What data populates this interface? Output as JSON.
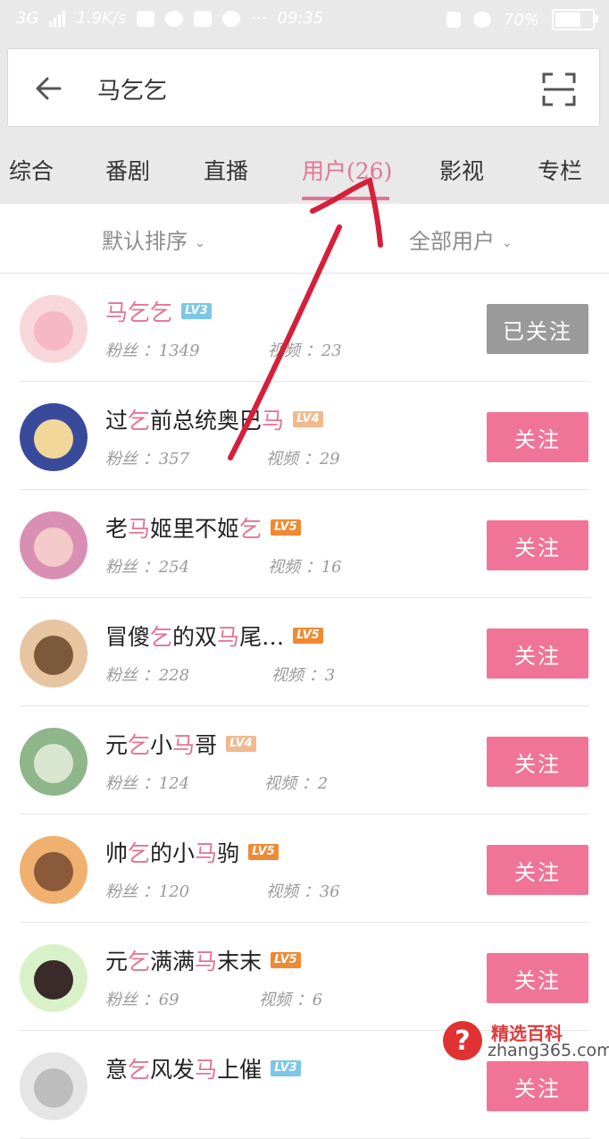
{
  "status_bar": {
    "network": "3G",
    "speed": "1.9K/s",
    "time": "09:35",
    "dots": "···",
    "battery": "70%"
  },
  "search": {
    "query": "马乞乞"
  },
  "tabs": [
    {
      "label": "综合"
    },
    {
      "label": "番剧"
    },
    {
      "label": "直播"
    },
    {
      "label": "用户(26)"
    },
    {
      "label": "影视"
    },
    {
      "label": "专栏"
    }
  ],
  "filters": {
    "sort": "默认排序",
    "scope": "全部用户"
  },
  "labels": {
    "fans": "粉丝 ：",
    "videos": "视频 ："
  },
  "colors": {
    "accent": "#e27595",
    "follow_button": "#f07497",
    "followed_button": "#9a9a9a",
    "lv3": "#7cc7e8",
    "lv4": "#f2b98f",
    "lv5": "#f08a32"
  },
  "users": [
    {
      "name_parts": [
        "马乞乞"
      ],
      "highlight": [
        true
      ],
      "level": "LV3",
      "fans": "1349",
      "videos": "23",
      "button": "已关注",
      "followed": true
    },
    {
      "name_parts": [
        "过",
        "乞",
        "前总统奥巴",
        "马"
      ],
      "highlight": [
        false,
        true,
        false,
        true
      ],
      "level": "LV4",
      "fans": "357",
      "videos": "29",
      "button": "关注",
      "followed": false
    },
    {
      "name_parts": [
        "老",
        "马",
        "姬里不姬",
        "乞"
      ],
      "highlight": [
        false,
        true,
        false,
        true
      ],
      "level": "LV5",
      "fans": "254",
      "videos": "16",
      "button": "关注",
      "followed": false
    },
    {
      "name_parts": [
        "冒傻",
        "乞",
        "的双",
        "马",
        "尾…"
      ],
      "highlight": [
        false,
        true,
        false,
        true,
        false
      ],
      "level": "LV5",
      "fans": "228",
      "videos": "3",
      "button": "关注",
      "followed": false
    },
    {
      "name_parts": [
        "元",
        "乞",
        "小",
        "马",
        "哥"
      ],
      "highlight": [
        false,
        true,
        false,
        true,
        false
      ],
      "level": "LV4",
      "fans": "124",
      "videos": "2",
      "button": "关注",
      "followed": false
    },
    {
      "name_parts": [
        "帅",
        "乞",
        "的小",
        "马",
        "驹"
      ],
      "highlight": [
        false,
        true,
        false,
        true,
        false
      ],
      "level": "LV5",
      "fans": "120",
      "videos": "36",
      "button": "关注",
      "followed": false
    },
    {
      "name_parts": [
        "元",
        "乞",
        "满满",
        "马",
        "末末"
      ],
      "highlight": [
        false,
        true,
        false,
        true,
        false
      ],
      "level": "LV5",
      "fans": "69",
      "videos": "6",
      "button": "关注",
      "followed": false
    },
    {
      "name_parts": [
        "意",
        "乞",
        "风发",
        "马",
        "上催"
      ],
      "highlight": [
        false,
        true,
        false,
        true,
        false
      ],
      "level": "LV3",
      "fans": "",
      "videos": "",
      "button": "关注",
      "followed": false
    }
  ],
  "watermark": {
    "title": "精选百科",
    "domain": "zhang365.com",
    "badge": "?"
  }
}
